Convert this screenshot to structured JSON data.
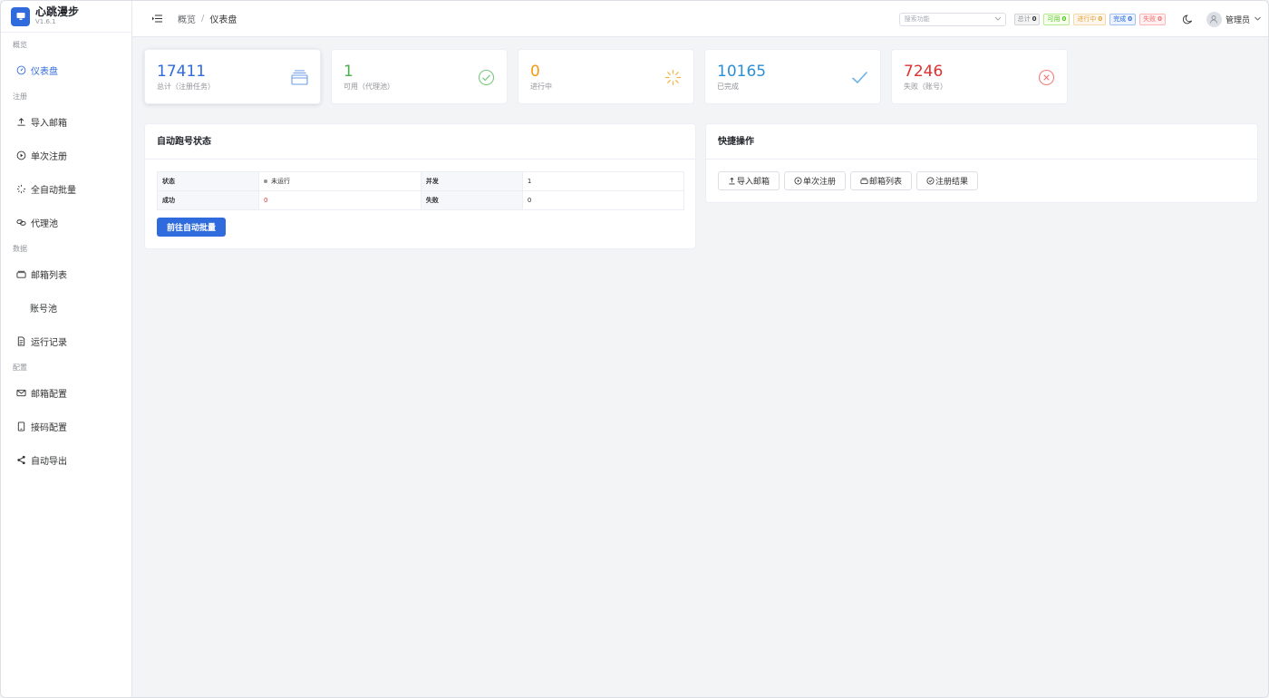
{
  "brand": {
    "name": "心跳漫步",
    "version": "V1.6.1"
  },
  "sidebar": {
    "groups": [
      {
        "title": "概览",
        "items": [
          {
            "label": "仪表盘",
            "icon": "dashboard-icon",
            "active": true
          }
        ]
      },
      {
        "title": "注册",
        "items": [
          {
            "label": "导入邮箱",
            "icon": "upload-icon"
          },
          {
            "label": "单次注册",
            "icon": "play-circle-icon"
          },
          {
            "label": "全自动批量",
            "icon": "loading-icon"
          },
          {
            "label": "代理池",
            "icon": "link-icon"
          }
        ]
      },
      {
        "title": "数据",
        "items": [
          {
            "label": "邮箱列表",
            "icon": "box-icon"
          },
          {
            "label": "账号池",
            "icon": ""
          },
          {
            "label": "运行记录",
            "icon": "document-icon"
          }
        ]
      },
      {
        "title": "配置",
        "items": [
          {
            "label": "邮箱配置",
            "icon": "mail-icon"
          },
          {
            "label": "接码配置",
            "icon": "phone-icon"
          },
          {
            "label": "自动导出",
            "icon": "share-icon"
          }
        ]
      }
    ]
  },
  "header": {
    "breadcrumb": [
      "概览",
      "仪表盘"
    ],
    "search_placeholder": "搜索功能",
    "tags": [
      {
        "label": "总计",
        "value": "0",
        "color": "#909399"
      },
      {
        "label": "可用",
        "value": "0",
        "color": "#52c41a"
      },
      {
        "label": "进行中",
        "value": "0",
        "color": "#e6a23c"
      },
      {
        "label": "完成",
        "value": "0",
        "color": "#2f6bdc"
      },
      {
        "label": "失败",
        "value": "0",
        "color": "#f56c6c"
      }
    ],
    "user_name": "管理员"
  },
  "stats": [
    {
      "value": "17411",
      "label": "总计（注册任务）",
      "color": "#2f6bdc",
      "icon": "box-icon"
    },
    {
      "value": "1",
      "label": "可用（代理池）",
      "color": "#4caf50",
      "icon": "check-circle-icon"
    },
    {
      "value": "0",
      "label": "进行中",
      "color": "#f39c12",
      "icon": "loading-icon"
    },
    {
      "value": "10165",
      "label": "已完成",
      "color": "#2b8fd6",
      "icon": "check-icon"
    },
    {
      "value": "7246",
      "label": "失败（账号）",
      "color": "#e03131",
      "icon": "close-circle-icon"
    }
  ],
  "auto_panel": {
    "title": "自动跑号状态",
    "rows": [
      {
        "l1": "状态",
        "v1": "未运行",
        "l2": "并发",
        "v2": "1"
      },
      {
        "l1": "成功",
        "v1": "0",
        "l2": "失败",
        "v2": "0"
      }
    ],
    "button": "前往自动批量"
  },
  "quick_panel": {
    "title": "快捷操作",
    "actions": [
      {
        "label": "导入邮箱",
        "icon": "upload-icon"
      },
      {
        "label": "单次注册",
        "icon": "play-circle-icon"
      },
      {
        "label": "邮箱列表",
        "icon": "box-icon"
      },
      {
        "label": "注册结果",
        "icon": "check-circle-icon"
      }
    ]
  }
}
